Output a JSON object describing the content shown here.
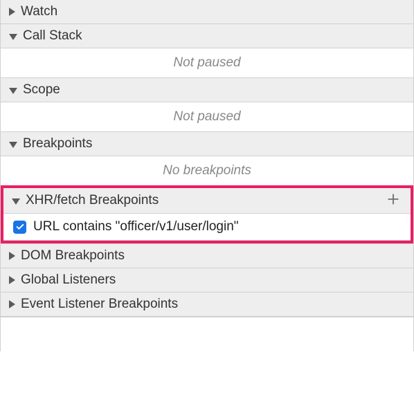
{
  "sections": {
    "watch": {
      "title": "Watch"
    },
    "callStack": {
      "title": "Call Stack",
      "body": "Not paused"
    },
    "scope": {
      "title": "Scope",
      "body": "Not paused"
    },
    "breakpoints": {
      "title": "Breakpoints",
      "body": "No breakpoints"
    },
    "xhrFetch": {
      "title": "XHR/fetch Breakpoints",
      "item": "URL contains \"officer/v1/user/login\"",
      "checked": true
    },
    "dom": {
      "title": "DOM Breakpoints"
    },
    "globalListeners": {
      "title": "Global Listeners"
    },
    "eventListener": {
      "title": "Event Listener Breakpoints"
    }
  }
}
